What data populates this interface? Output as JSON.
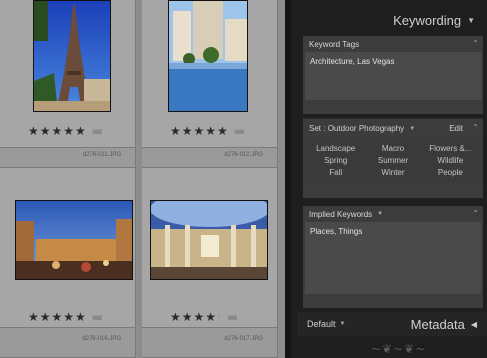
{
  "grid": {
    "cells": [
      {
        "filename": "d276-011.JPG",
        "rating": 5,
        "max_rating": 5
      },
      {
        "filename": "d276-012.JPG",
        "rating": 5,
        "max_rating": 5
      },
      {
        "filename": "d276-016.JPG",
        "rating": 5,
        "max_rating": 5
      },
      {
        "filename": "d276-017.JPG",
        "rating": 4,
        "max_rating": 5
      }
    ]
  },
  "panel": {
    "header_title": "Keywording",
    "keyword_tags": {
      "title": "Keyword Tags",
      "value": "Architecture, Las Vegas"
    },
    "keyword_set": {
      "label": "Set :",
      "selected": "Outdoor Photography",
      "edit_label": "Edit",
      "keywords": [
        "Landscape",
        "Macro",
        "Flowers &...",
        "Spring",
        "Summer",
        "Wildlife",
        "Fall",
        "Winter",
        "People"
      ]
    },
    "implied_keywords": {
      "title": "Implied Keywords",
      "value": "Places, Things"
    },
    "footer": {
      "default_label": "Default",
      "metadata_label": "Metadata"
    }
  },
  "colors": {
    "panel_bg": "#1e1e1e",
    "grid_bg": "#a6a6a6",
    "field_bg": "#4a4a4a"
  }
}
